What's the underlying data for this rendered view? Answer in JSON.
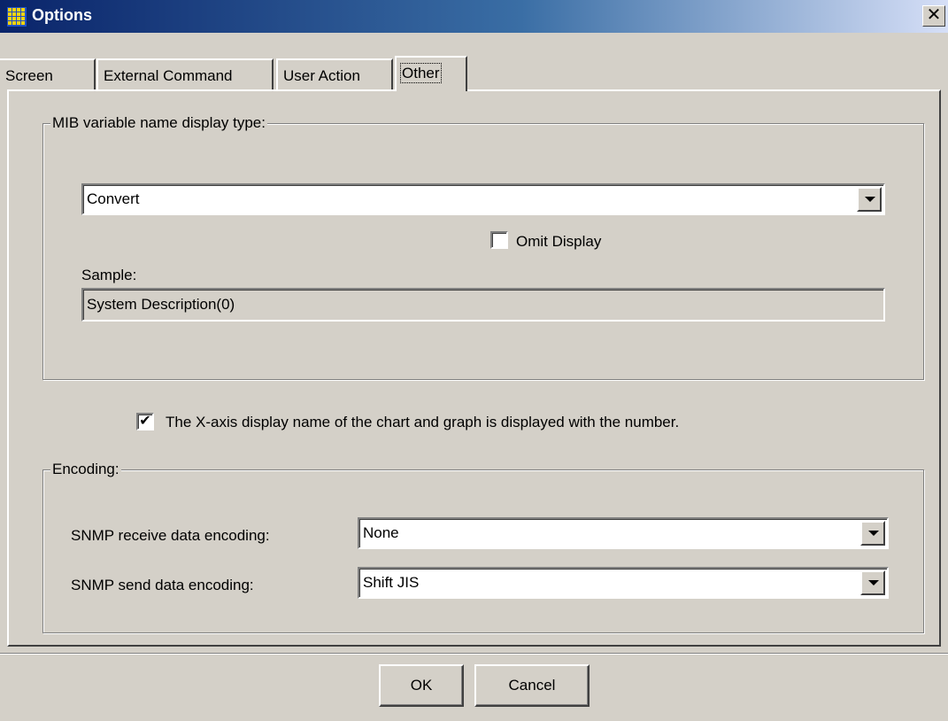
{
  "window": {
    "title": "Options",
    "close_glyph": "✕"
  },
  "tabs": [
    {
      "label": "Screen",
      "active": false
    },
    {
      "label": "External Command",
      "active": false
    },
    {
      "label": "User Action",
      "active": false
    },
    {
      "label": "Other",
      "active": true
    }
  ],
  "mib_group": {
    "legend": "MIB variable name display type:",
    "display_type": {
      "value": "Convert"
    },
    "omit_display": {
      "label": "Omit Display",
      "checked": false
    },
    "sample_label": "Sample:",
    "sample_value": "System Description(0)"
  },
  "x_axis_option": {
    "label": "The X-axis display name of the chart and graph is displayed with the number.",
    "checked": true
  },
  "encoding_group": {
    "legend": "Encoding:",
    "receive": {
      "label": "SNMP receive data encoding:",
      "value": "None"
    },
    "send": {
      "label": "SNMP send data encoding:",
      "value": "Shift JIS"
    }
  },
  "buttons": {
    "ok": "OK",
    "cancel": "Cancel"
  },
  "icons": {
    "app": "grid-app-icon",
    "close": "close-icon",
    "dropdown": "chevron-down-icon",
    "check": "checkmark-icon"
  },
  "colors": {
    "titlebar_start": "#0a246a",
    "titlebar_end": "#d6dff7",
    "dialog_bg": "#d4d0c8"
  }
}
